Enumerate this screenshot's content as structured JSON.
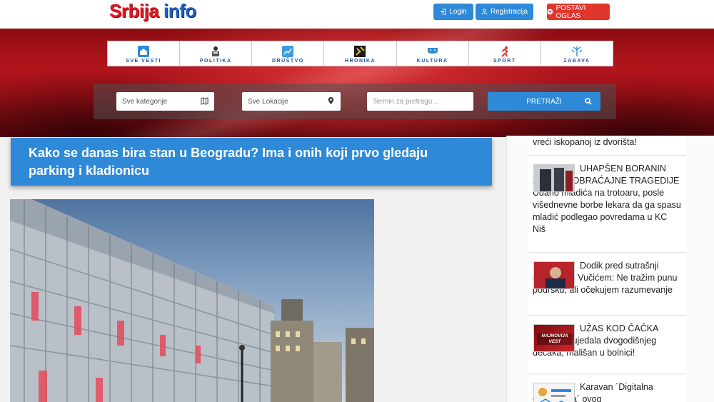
{
  "header": {
    "logo_part1": "Srbija",
    "logo_part2": "info",
    "login_label": "Login",
    "register_label": "Registracija",
    "post_ad_label": "POSTAVI OGLAS"
  },
  "categories": [
    {
      "label": "SVE VESTI",
      "icon": "home-icon"
    },
    {
      "label": "POLITIKA",
      "icon": "speaker-icon"
    },
    {
      "label": "DRUŠTVO",
      "icon": "chart-icon"
    },
    {
      "label": "HRONIKA",
      "icon": "gavel-icon"
    },
    {
      "label": "KULTURA",
      "icon": "theater-icon"
    },
    {
      "label": "SPORT",
      "icon": "runner-icon"
    },
    {
      "label": "ZABAVA",
      "icon": "fireworks-icon"
    }
  ],
  "search": {
    "category_select": "Sve kategorije",
    "location_select": "Sve Lokacije",
    "term_placeholder": "Termin za pretragu...",
    "search_button": "PRETRAŽI"
  },
  "article": {
    "title": "Kako se danas bira stan u Beogradu? Ima i onih koji prvo gledaju parking i kladionicu"
  },
  "sidebar": {
    "items": [
      {
        "text": "vreći iskopanoj iz dvorišta!"
      },
      {
        "text": "UHAPŠEN BORANIN ZBOG SAOBRAĆAJNE TRAGEDIJE Udario mladića na trotoaru, posle višednevne borbe lekara da ga spasu mladić podlegao povredama u KC Niš"
      },
      {
        "text": "Dodik pred sutrašnji sastanak s Vučićem: Ne tražim punu podršku, ali očekujem razumevanje"
      },
      {
        "text": "UŽAS KOD ČAČKA Lutalica izujedala dvogodišnjeg dečaka, mališan u bolnici!",
        "badge": "NAJNOVIJA VEST"
      },
      {
        "text": "Karavan ´Digitalna ekspedicija´ ovog"
      }
    ]
  },
  "colors": {
    "accent_blue": "#2e8ad8",
    "accent_red": "#e0362c",
    "hero_red": "#b3151c"
  }
}
